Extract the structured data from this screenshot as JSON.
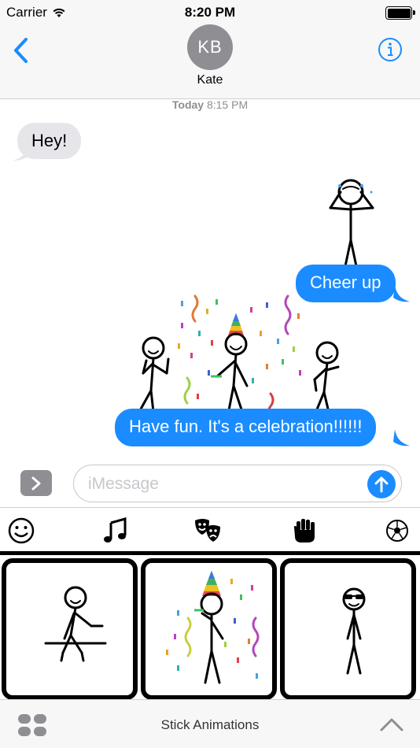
{
  "status_bar": {
    "carrier": "Carrier",
    "time": "8:20 PM"
  },
  "header": {
    "avatar_initials": "KB",
    "contact_name": "Kate"
  },
  "timestamp": {
    "day": "Today",
    "time": "8:15 PM"
  },
  "messages": [
    {
      "direction": "incoming",
      "text": "Hey!"
    },
    {
      "direction": "outgoing",
      "text": "Cheer up"
    },
    {
      "direction": "outgoing",
      "text": "Have fun. It's a celebration!!!!!!"
    }
  ],
  "compose": {
    "placeholder": "iMessage"
  },
  "categories": [
    "smiley-icon",
    "music-note-icon",
    "theater-masks-icon",
    "raised-fist-icon",
    "soccer-ball-icon"
  ],
  "app_drawer": {
    "title": "Stick Animations"
  },
  "colors": {
    "imessage_blue": "#1a8cff",
    "incoming_gray": "#e5e5ea",
    "ios_gray": "#8e8e93"
  }
}
